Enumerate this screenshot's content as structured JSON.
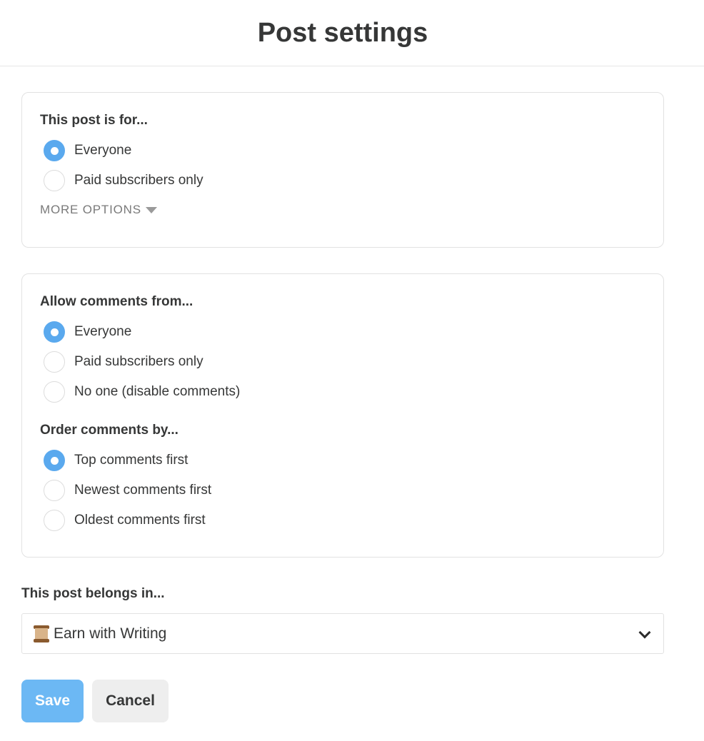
{
  "page": {
    "title": "Post settings"
  },
  "audience": {
    "label": "This post is for...",
    "options": [
      {
        "label": "Everyone",
        "selected": true
      },
      {
        "label": "Paid subscribers only",
        "selected": false
      }
    ],
    "more_options_label": "MORE OPTIONS"
  },
  "comments": {
    "label": "Allow comments from...",
    "options": [
      {
        "label": "Everyone",
        "selected": true
      },
      {
        "label": "Paid subscribers only",
        "selected": false
      },
      {
        "label": "No one (disable comments)",
        "selected": false
      }
    ]
  },
  "order": {
    "label": "Order comments by...",
    "options": [
      {
        "label": "Top comments first",
        "selected": true
      },
      {
        "label": "Newest comments first",
        "selected": false
      },
      {
        "label": "Oldest comments first",
        "selected": false
      }
    ]
  },
  "section": {
    "label": "This post belongs in...",
    "selected_value": "Earn with Writing",
    "icon": "scroll-icon"
  },
  "actions": {
    "save_label": "Save",
    "cancel_label": "Cancel"
  },
  "colors": {
    "accent": "#5aa9ee",
    "save_button": "#6cb8f4",
    "text": "#363737"
  }
}
